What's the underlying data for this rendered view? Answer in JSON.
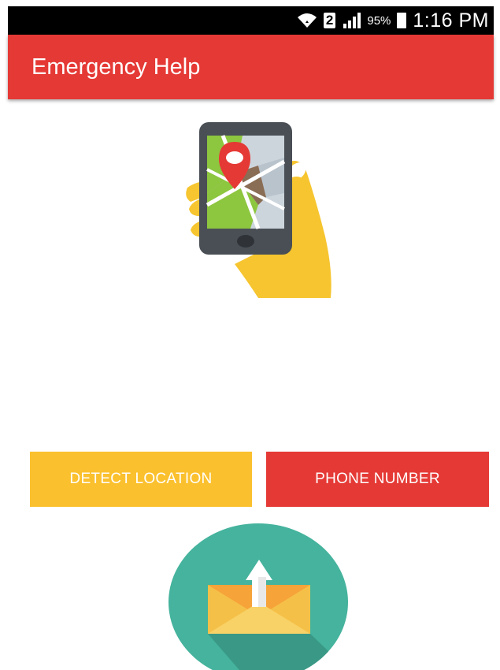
{
  "status_bar": {
    "sim_slot": "2",
    "battery_percent": "95%",
    "time": "1:16 PM",
    "icons": [
      "wifi-icon",
      "signal-icon",
      "battery-icon"
    ]
  },
  "app_bar": {
    "title": "Emergency Help",
    "color": "#e53935"
  },
  "illustration": {
    "icon": "phone-map-location-icon"
  },
  "buttons": {
    "detect_location": {
      "label": "DETECT LOCATION",
      "color": "#fbc02d"
    },
    "phone_number": {
      "label": "PHONE NUMBER",
      "color": "#e53935"
    }
  },
  "send_button": {
    "icon": "send-mail-icon",
    "color": "#45b39d"
  }
}
